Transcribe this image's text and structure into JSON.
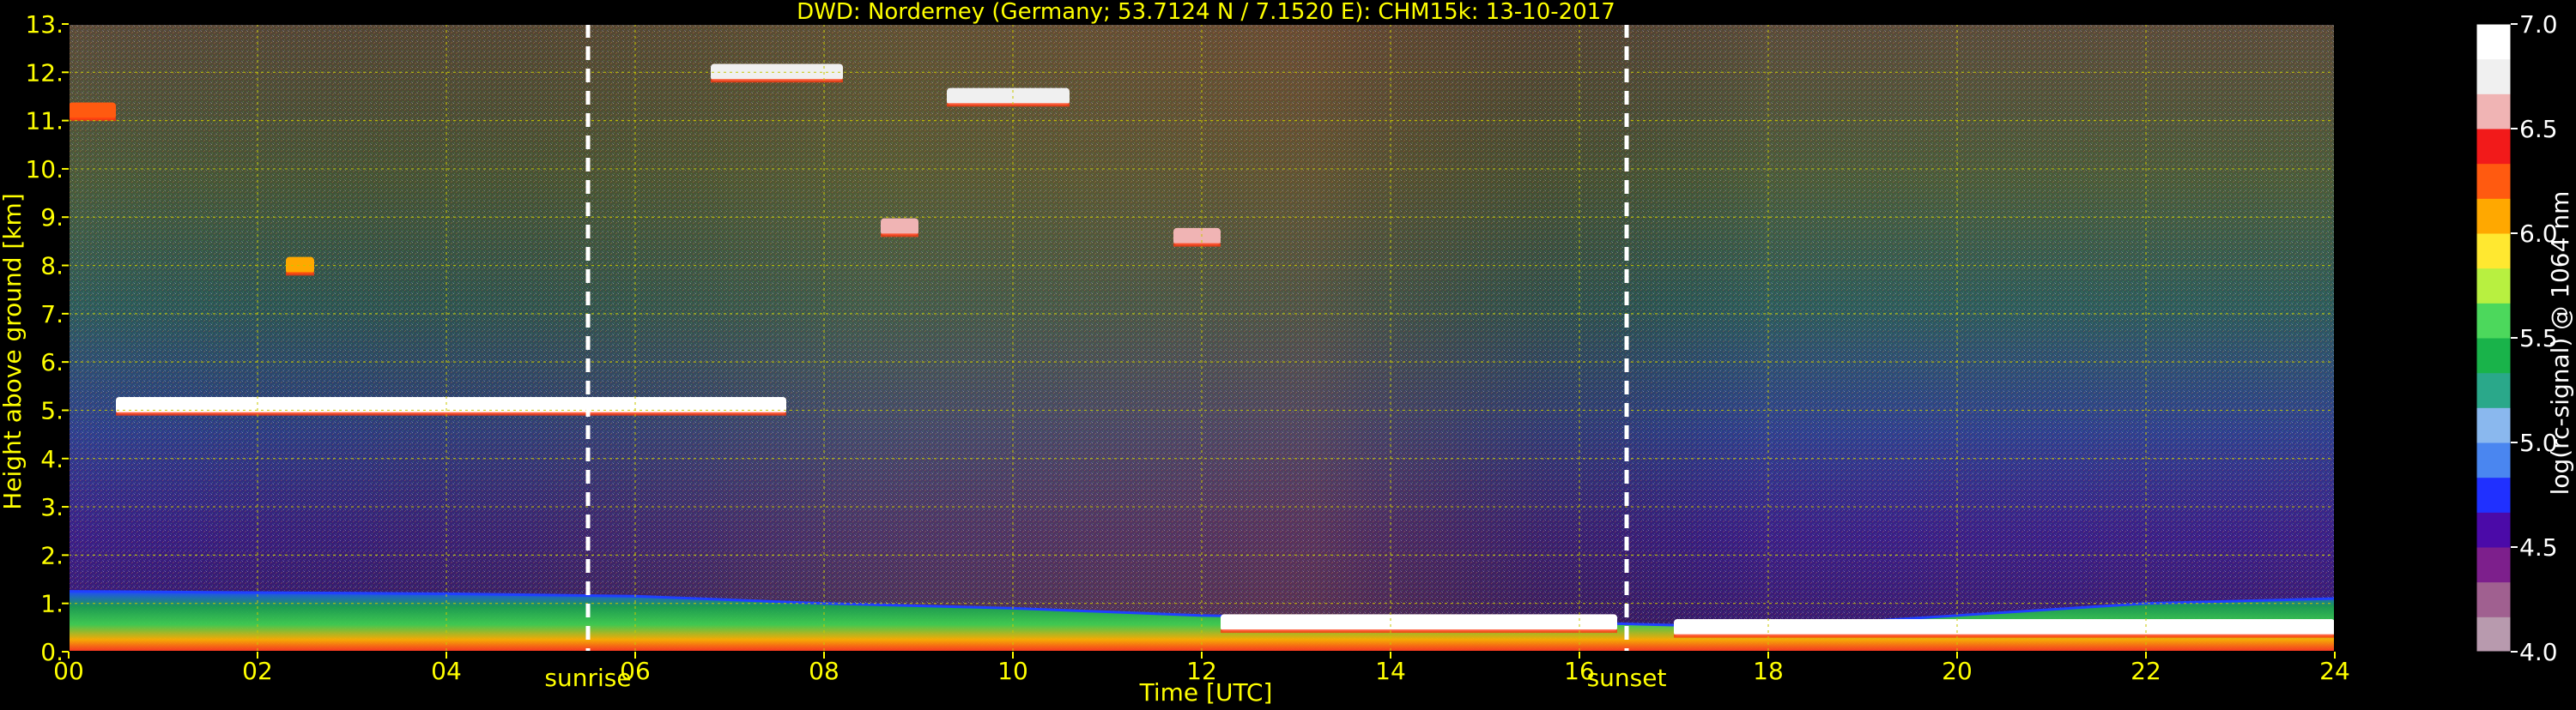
{
  "chart_data": {
    "type": "heatmap",
    "title": "DWD: Norderney (Germany; 53.7124 N / 7.1520 E):    CHM15k: 13-10-2017",
    "xlabel": "Time [UTC]",
    "ylabel": "Height above ground [km]",
    "xlim": [
      0,
      24
    ],
    "ylim": [
      0,
      13
    ],
    "x_ticks": [
      "00",
      "02",
      "04",
      "06",
      "08",
      "10",
      "12",
      "14",
      "16",
      "18",
      "20",
      "22",
      "24"
    ],
    "x_tick_values": [
      0,
      2,
      4,
      6,
      8,
      10,
      12,
      14,
      16,
      18,
      20,
      22,
      24
    ],
    "y_ticks": [
      "0.",
      "1.",
      "2.",
      "3.",
      "4.",
      "5.",
      "6.",
      "7.",
      "8.",
      "9.",
      "10.",
      "11.",
      "12.",
      "13."
    ],
    "y_tick_values": [
      0,
      1,
      2,
      3,
      4,
      5,
      6,
      7,
      8,
      9,
      10,
      11,
      12,
      13
    ],
    "grid": true,
    "colorbar": {
      "label": "log(rc-signal) @ 1064 nm",
      "range": [
        4.0,
        7.0
      ],
      "ticks": [
        "4.0",
        "4.5",
        "5.0",
        "5.5",
        "6.0",
        "6.5",
        "7.0"
      ],
      "tick_values": [
        4.0,
        4.5,
        5.0,
        5.5,
        6.0,
        6.5,
        7.0
      ],
      "colors": [
        "#b89aae",
        "#a06090",
        "#7d1f8c",
        "#4b0aa8",
        "#2030ff",
        "#4a86f0",
        "#8ab8ee",
        "#2aa88a",
        "#19b34a",
        "#4cd85c",
        "#b8f040",
        "#ffe830",
        "#ffa800",
        "#ff5a10",
        "#f21a1a",
        "#f0b4b4",
        "#f0f0f0",
        "#ffffff"
      ]
    },
    "annotations": [
      {
        "label": "sunrise",
        "x": 5.5
      },
      {
        "label": "sunset",
        "x": 16.5
      }
    ],
    "cloud_layers": [
      {
        "x_start": 0.5,
        "x_end": 7.6,
        "height_km": 5.1,
        "signal": 7.0
      },
      {
        "x_start": 6.8,
        "x_end": 8.2,
        "height_km": 12.0,
        "signal": 6.8
      },
      {
        "x_start": 9.3,
        "x_end": 10.6,
        "height_km": 11.5,
        "signal": 6.8
      },
      {
        "x_start": 8.6,
        "x_end": 9.0,
        "height_km": 8.8,
        "signal": 6.6
      },
      {
        "x_start": 11.7,
        "x_end": 12.2,
        "height_km": 8.6,
        "signal": 6.6
      },
      {
        "x_start": 2.3,
        "x_end": 2.6,
        "height_km": 8.0,
        "signal": 6.0
      },
      {
        "x_start": 0.0,
        "x_end": 0.5,
        "height_km": 11.2,
        "signal": 6.2
      },
      {
        "x_start": 12.2,
        "x_end": 16.4,
        "height_km": 0.6,
        "signal": 7.0
      },
      {
        "x_start": 17.0,
        "x_end": 24.0,
        "height_km": 0.5,
        "signal": 7.0
      }
    ],
    "boundary_layer": [
      {
        "x": 0,
        "top_km": 1.25
      },
      {
        "x": 4,
        "top_km": 1.2
      },
      {
        "x": 6,
        "top_km": 1.15
      },
      {
        "x": 8,
        "top_km": 1.0
      },
      {
        "x": 10,
        "top_km": 0.9
      },
      {
        "x": 12,
        "top_km": 0.75
      },
      {
        "x": 16,
        "top_km": 0.6
      },
      {
        "x": 18,
        "top_km": 0.5
      },
      {
        "x": 22,
        "top_km": 1.0
      },
      {
        "x": 24,
        "top_km": 1.1
      }
    ]
  }
}
